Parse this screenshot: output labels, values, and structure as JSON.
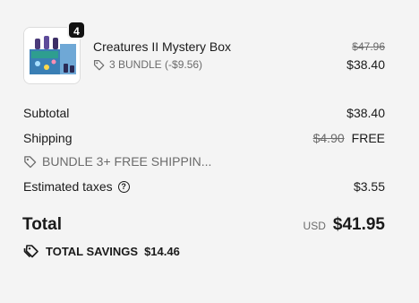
{
  "line_item": {
    "quantity": "4",
    "title": "Creatures II Mystery Box",
    "discount_label": "3 BUNDLE (-$9.56)",
    "original_price": "$47.96",
    "price": "$38.40",
    "image_icon": "product-box-image"
  },
  "summary": {
    "subtotal_label": "Subtotal",
    "subtotal_value": "$38.40",
    "shipping_label": "Shipping",
    "shipping_original": "$4.90",
    "shipping_value": "FREE",
    "shipping_discount_label": "BUNDLE 3+ FREE SHIPPIN...",
    "taxes_label": "Estimated taxes",
    "taxes_help_icon": "?",
    "taxes_value": "$3.55",
    "total_label": "Total",
    "currency": "USD",
    "total_value": "$41.95",
    "savings_label": "TOTAL SAVINGS",
    "savings_value": "$14.46"
  },
  "colors": {
    "background": "#f4f4f4",
    "text": "#1a1a1a",
    "muted": "#6b6b6b",
    "badge": "#111111"
  }
}
